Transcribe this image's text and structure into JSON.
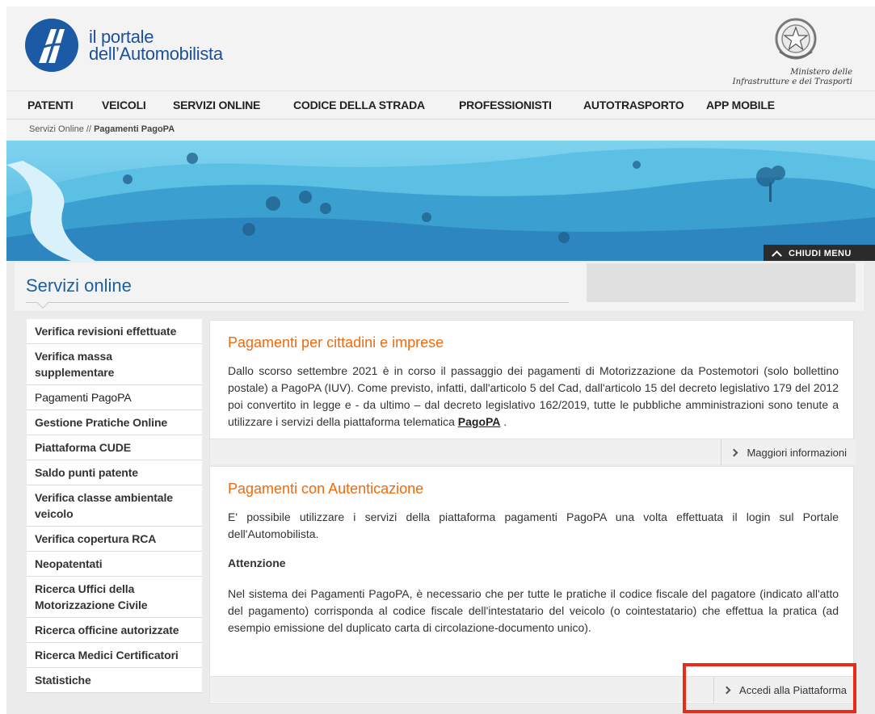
{
  "header": {
    "logo_line1": "il portale",
    "logo_line2": "dell’Automobilista",
    "ministry_line1": "Ministero delle",
    "ministry_line2": "Infrastrutture e dei Trasporti"
  },
  "nav": {
    "items": [
      "PATENTI",
      "VEICOLI",
      "SERVIZI ONLINE",
      "CODICE DELLA STRADA",
      "PROFESSIONISTI",
      "AUTOTRASPORTO",
      "APP MOBILE"
    ]
  },
  "breadcrumb": {
    "parent": "Servizi Online",
    "separator": " // ",
    "current": "Pagamenti PagoPA"
  },
  "banner": {
    "close_menu_label": "CHIUDI MENU"
  },
  "page": {
    "title": "Servizi online"
  },
  "sidebar": {
    "items": [
      {
        "label": "Verifica revisioni effettuate",
        "active": false
      },
      {
        "label": "Verifica massa supplementare",
        "active": false
      },
      {
        "label": "Pagamenti PagoPA",
        "active": true
      },
      {
        "label": "Gestione Pratiche Online",
        "active": false
      },
      {
        "label": "Piattaforma CUDE",
        "active": false
      },
      {
        "label": "Saldo punti patente",
        "active": false
      },
      {
        "label": "Verifica classe ambientale veicolo",
        "active": false
      },
      {
        "label": "Verifica copertura RCA",
        "active": false
      },
      {
        "label": "Neopatentati",
        "active": false
      },
      {
        "label": "Ricerca Uffici della Motorizzazione Civile",
        "active": false
      },
      {
        "label": "Ricerca officine autorizzate",
        "active": false
      },
      {
        "label": "Ricerca Medici Certificatori",
        "active": false
      },
      {
        "label": "Statistiche",
        "active": false
      }
    ]
  },
  "card1": {
    "title": "Pagamenti per cittadini e imprese",
    "body": "Dallo scorso settembre 2021 è in corso il passaggio dei pagamenti di Motorizzazione da Postemotori (solo bollettino postale) a PagoPA (IUV). Come previsto, infatti, dall'articolo 5 del Cad, dall'articolo 15 del decreto legislativo 179 del 2012 poi convertito in legge e - da ultimo – dal decreto legislativo 162/2019, tutte le pubbliche amministrazioni sono tenute a utilizzare i servizi della piattaforma telematica",
    "link_text": "PagoPA",
    "body_end": " .",
    "footer_link": "Maggiori informazioni"
  },
  "card2": {
    "title": "Pagamenti con Autenticazione",
    "intro": "E' possibile utilizzare i servizi della piattaforma pagamenti PagoPA una volta effettuata il login sul Portale dell'Automobilista.",
    "warning_title": "Attenzione",
    "warning_body": "Nel sistema dei Pagamenti PagoPA, è necessario che per tutte le pratiche il codice fiscale del pagatore (indicato all'atto del pagamento) corrisponda al codice fiscale dell'intestatario del veicolo (o cointestatario) che effettua la pratica (ad esempio emissione del duplicato carta di circolazione-documento unico).",
    "footer_link": "Accedi alla Piattaforma"
  },
  "colors": {
    "brand_blue": "#1d5f9c",
    "title_orange": "#f06a0b",
    "highlight_red": "#ec2a18"
  }
}
